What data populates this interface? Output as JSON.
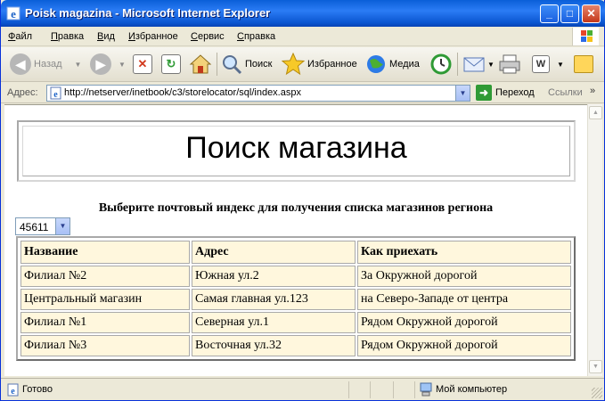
{
  "window": {
    "title": "Poisk magazina - Microsoft Internet Explorer"
  },
  "menu": [
    {
      "label": "Файл",
      "accel": "Ф",
      "rest": "айл"
    },
    {
      "label": "Правка",
      "accel": "П",
      "rest": "равка"
    },
    {
      "label": "Вид",
      "accel": "В",
      "rest": "ид"
    },
    {
      "label": "Избранное",
      "accel": "И",
      "rest": "збранное"
    },
    {
      "label": "Сервис",
      "accel": "С",
      "rest": "ервис"
    },
    {
      "label": "Справка",
      "accel": "С",
      "rest": "правка"
    }
  ],
  "toolbar": {
    "back": "Назад",
    "search": "Поиск",
    "favorites": "Избранное",
    "media": "Медиа"
  },
  "address": {
    "label": "Адрес:",
    "url": "http://netserver/inetbook/c3/storelocator/sql/index.aspx",
    "go": "Переход",
    "links": "Ссылки",
    "more": "»"
  },
  "page": {
    "heading": "Поиск магазина",
    "prompt": "Выберите почтовый индекс для получения списка магазинов региона",
    "zip_selected": "45611",
    "table": {
      "headers": [
        "Название",
        "Адрес",
        "Как приехать"
      ],
      "rows": [
        [
          "Филиал №2",
          "Южная ул.2",
          "За Окружной дорогой"
        ],
        [
          "Центральный магазин",
          "Самая главная ул.123",
          "на Северо-Западе от центра"
        ],
        [
          "Филиал №1",
          "Северная ул.1",
          "Рядом Окружной дорогой"
        ],
        [
          "Филиал №3",
          "Восточная ул.32",
          "Рядом Окружной дорогой"
        ]
      ]
    }
  },
  "status": {
    "text": "Готово",
    "zone": "Мой компьютер"
  },
  "colors": {
    "titlebar": "#0a5fd8",
    "table_cell": "#fff7dd",
    "chrome": "#ece9d8"
  }
}
